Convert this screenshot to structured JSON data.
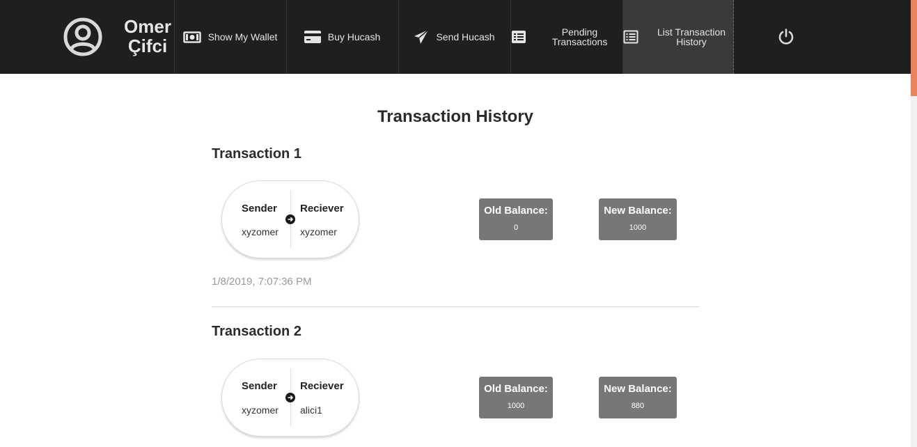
{
  "user": {
    "name_line1": "Omer",
    "name_line2": "Çifci",
    "avatar_icon": "user-circle-icon"
  },
  "nav": [
    {
      "label": "Show My Wallet",
      "icon": "money-bill-icon"
    },
    {
      "label": "Buy Hucash",
      "icon": "credit-card-icon"
    },
    {
      "label": "Send Hucash",
      "icon": "paper-plane-icon"
    },
    {
      "label": "Pending Transactions",
      "icon": "list-icon"
    },
    {
      "label": "List Transaction History",
      "icon": "list-alt-icon",
      "active": true
    }
  ],
  "power_icon": "power-icon",
  "page": {
    "title": "Transaction History"
  },
  "transactions": [
    {
      "heading": "Transaction 1",
      "sender_label": "Sender",
      "sender": "xyzomer",
      "receiver_label": "Reciever",
      "receiver": "xyzomer",
      "old_balance_label": "Old Balance:",
      "old_balance": "0",
      "new_balance_label": "New Balance:",
      "new_balance": "1000",
      "timestamp": "1/8/2019, 7:07:36 PM"
    },
    {
      "heading": "Transaction 2",
      "sender_label": "Sender",
      "sender": "xyzomer",
      "receiver_label": "Reciever",
      "receiver": "alici1",
      "old_balance_label": "Old Balance:",
      "old_balance": "1000",
      "new_balance_label": "New Balance:",
      "new_balance": "880"
    }
  ],
  "colors": {
    "nav_bg": "#1f1f21",
    "nav_active": "#3a3a3d",
    "balance_box": "#777777",
    "scroll_thumb": "#e9855e"
  }
}
